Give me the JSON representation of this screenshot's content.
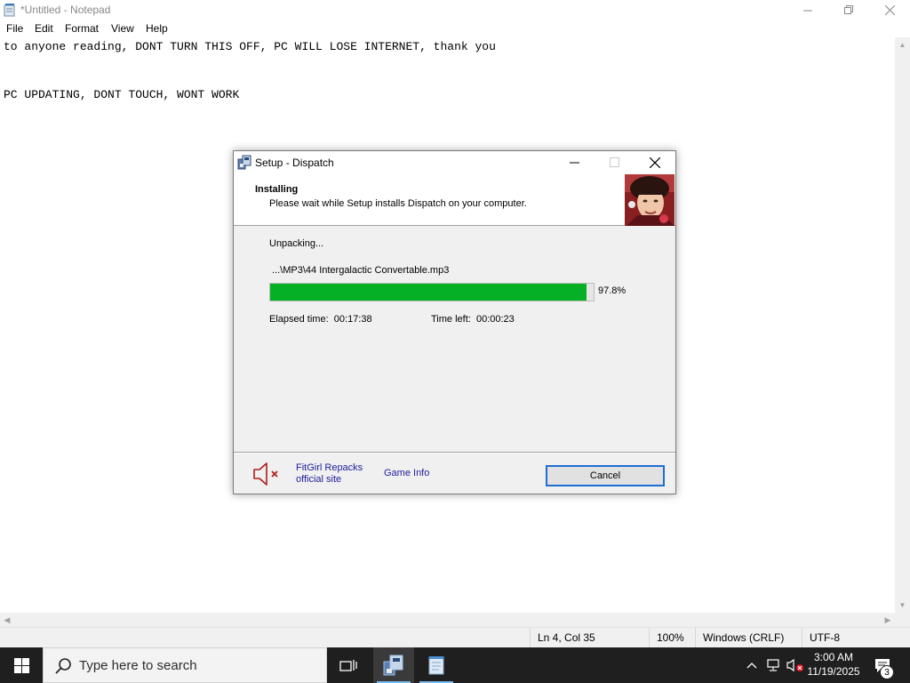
{
  "notepad": {
    "title": "*Untitled - Notepad",
    "menu": [
      "File",
      "Edit",
      "Format",
      "View",
      "Help"
    ],
    "lines": [
      "to anyone reading, DONT TURN THIS OFF, PC WILL LOSE INTERNET, thank you",
      "",
      "PC UPDATING, DONT TOUCH, WONT WORK"
    ],
    "status": {
      "position": "Ln 4, Col 35",
      "zoom": "100%",
      "line_ending": "Windows (CRLF)",
      "encoding": "UTF-8"
    }
  },
  "setup": {
    "title": "Setup - Dispatch",
    "header_title": "Installing",
    "header_subtitle": "Please wait while Setup installs Dispatch on your computer.",
    "status_text": "Unpacking...",
    "current_file": "...\\MP3\\44 Intergalactic Convertable.mp3",
    "progress_value": 0.978,
    "progress_text": "97.8%",
    "elapsed_label": "Elapsed time:",
    "elapsed_value": "00:17:38",
    "remaining_label": "Time left:",
    "remaining_value": "00:00:23",
    "link_fitgirl_line1": "FitGirl Repacks",
    "link_fitgirl_line2": "official site",
    "link_game_info": "Game Info",
    "cancel_label": "Cancel",
    "icons": [
      "setup-app-icon",
      "minimize-icon",
      "maximize-icon",
      "close-icon",
      "muted-speaker-icon"
    ]
  },
  "taskbar": {
    "search_placeholder": "Type here to search",
    "clock_time": "3:00 AM",
    "clock_date": "11/19/2025",
    "notification_count": "3",
    "icons": [
      "windows-start-icon",
      "search-icon",
      "task-view-icon",
      "setup-taskbar-icon",
      "notepad-taskbar-icon",
      "chevron-up-icon",
      "network-icon",
      "volume-muted-icon",
      "notification-icon"
    ]
  },
  "colors": {
    "progress_green": "#06b025",
    "link_blue": "#1c1c9c",
    "button_focus": "#1e6fd1",
    "taskbar_bg": "#1f1f1f",
    "muted_red": "#b01c1c"
  }
}
